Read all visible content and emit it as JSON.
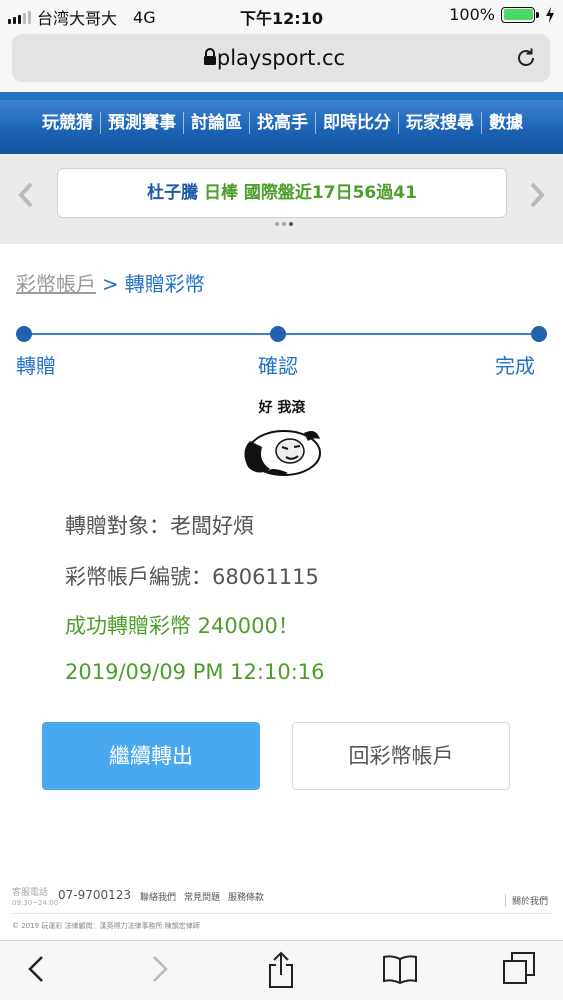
{
  "status_bar": {
    "carrier": "台湾大哥大",
    "network": "4G",
    "time": "下午12:10",
    "battery": "100%"
  },
  "browser": {
    "url": "playsport.cc"
  },
  "nav": {
    "items": [
      "玩競猜",
      "預測賽事",
      "討論區",
      "找高手",
      "即時比分",
      "玩家搜尋",
      "數據"
    ]
  },
  "marquee": {
    "name": "杜子騰",
    "sport": "日棒",
    "record": "國際盤近17日56過41"
  },
  "breadcrumb": {
    "parent": "彩幣帳戶",
    "separator": ">",
    "current": "轉贈彩幣"
  },
  "steps": [
    "轉贈",
    "確認",
    "完成"
  ],
  "meme": {
    "caption": "好 我滾",
    "icon": "panda-meme"
  },
  "result": {
    "recipient": "轉贈對象：老闆好煩",
    "account": "彩幣帳戶編號：68061115",
    "success": "成功轉贈彩幣 240000！",
    "datetime": "2019/09/09 PM 12:10:16"
  },
  "buttons": {
    "continue": "繼續轉出",
    "back": "回彩幣帳戶"
  },
  "footer": {
    "service_label": "客服電話",
    "service_hours": "09:30~24:00",
    "phone": "07-9700123",
    "links": [
      "聯絡我們",
      "常見問題",
      "服務條款"
    ],
    "about": "關於我們",
    "copyright": "© 2019 玩運彩 法律顧問：漢英得力法律事務所 陳韻宏律師"
  },
  "colors": {
    "brand_blue": "#2472c4",
    "success_green": "#4e9e2c",
    "button_blue": "#4aa8ee"
  }
}
